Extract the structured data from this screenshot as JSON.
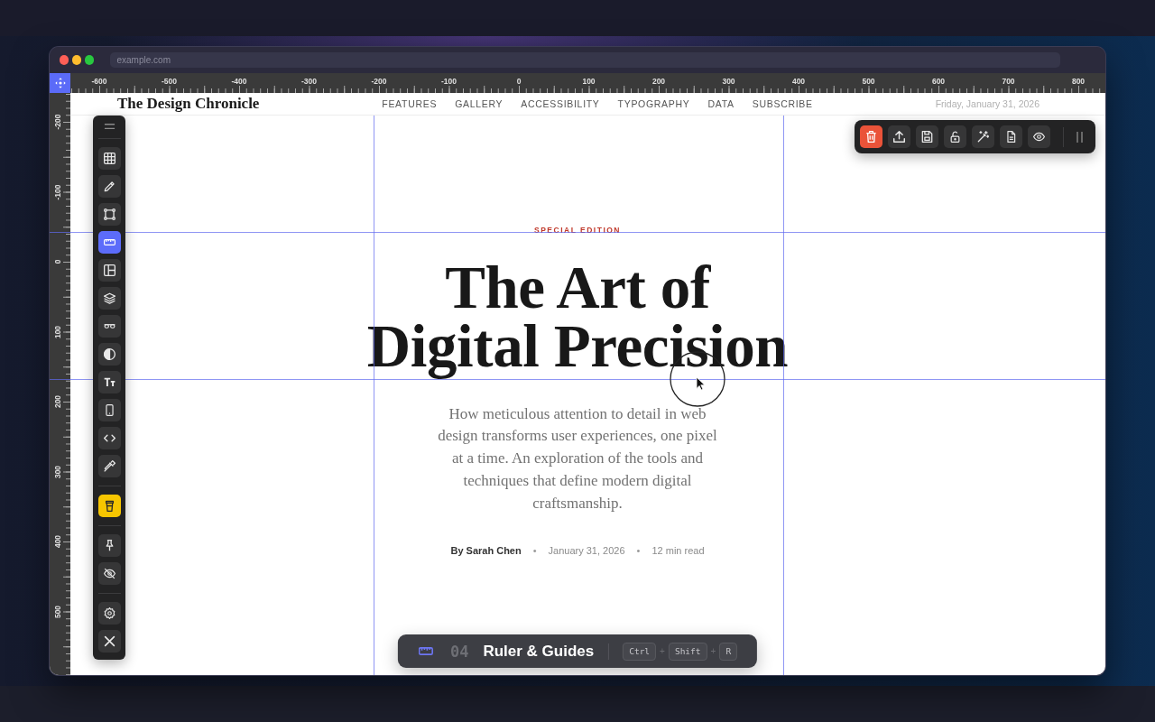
{
  "browser": {
    "url": "example.com"
  },
  "rulers": {
    "horizontal_labels": [
      "-600",
      "-500",
      "-400",
      "-300",
      "-200",
      "-100",
      "0",
      "100",
      "200",
      "300",
      "400",
      "500",
      "600",
      "700",
      "800"
    ],
    "vertical_labels": [
      "-200",
      "-100",
      "0",
      "100",
      "200",
      "300",
      "400",
      "500"
    ]
  },
  "site_header": {
    "logo": "The Design Chronicle",
    "nav": [
      "FEATURES",
      "GALLERY",
      "ACCESSIBILITY",
      "TYPOGRAPHY",
      "DATA",
      "SUBSCRIBE"
    ],
    "date": "Friday, January 31, 2026"
  },
  "article": {
    "kicker": "SPECIAL EDITION",
    "title": "The Art of Digital Precision",
    "dek": "How meticulous attention to detail in web design transforms user experiences, one pixel at a time. An exploration of the tools and techniques that define modern digital craftsmanship.",
    "byline": {
      "author": "By Sarah Chen",
      "date": "January 31, 2026",
      "read_time": "12 min read",
      "separators": [
        "•",
        "•"
      ]
    }
  },
  "tool_panel": {
    "tools": [
      {
        "selected": false
      },
      {
        "selected": false
      },
      {
        "selected": false
      },
      {
        "selected": true
      },
      {
        "selected": false
      },
      {
        "selected": false
      },
      {
        "selected": false
      },
      {
        "selected": false
      },
      {
        "selected": false
      },
      {
        "selected": false
      },
      {
        "selected": false
      },
      {
        "selected": false
      }
    ]
  },
  "tool_hint": {
    "number": "04",
    "name": "Ruler & Guides",
    "keys": [
      "Ctrl",
      "Shift",
      "R"
    ],
    "separators": [
      "+",
      "+"
    ]
  }
}
